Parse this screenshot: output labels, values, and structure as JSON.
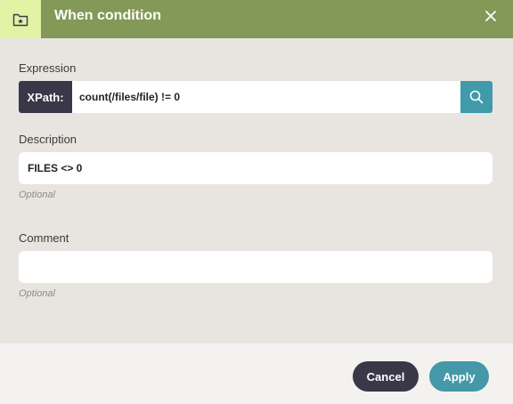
{
  "dialog": {
    "title": "When condition",
    "header_icon": "folder-star-icon",
    "close_icon": "close-icon"
  },
  "expression": {
    "label": "Expression",
    "prefix": "XPath:",
    "value": "count(/files/file) != 0",
    "search_icon": "search-icon"
  },
  "description": {
    "label": "Description",
    "value": "FILES <> 0",
    "helper": "Optional"
  },
  "comment": {
    "label": "Comment",
    "value": "",
    "helper": "Optional"
  },
  "buttons": {
    "cancel": "Cancel",
    "apply": "Apply"
  },
  "colors": {
    "header": "#849858",
    "header_icon_bg": "#e3f2a4",
    "dark": "#3a3848",
    "accent": "#4598a8"
  }
}
